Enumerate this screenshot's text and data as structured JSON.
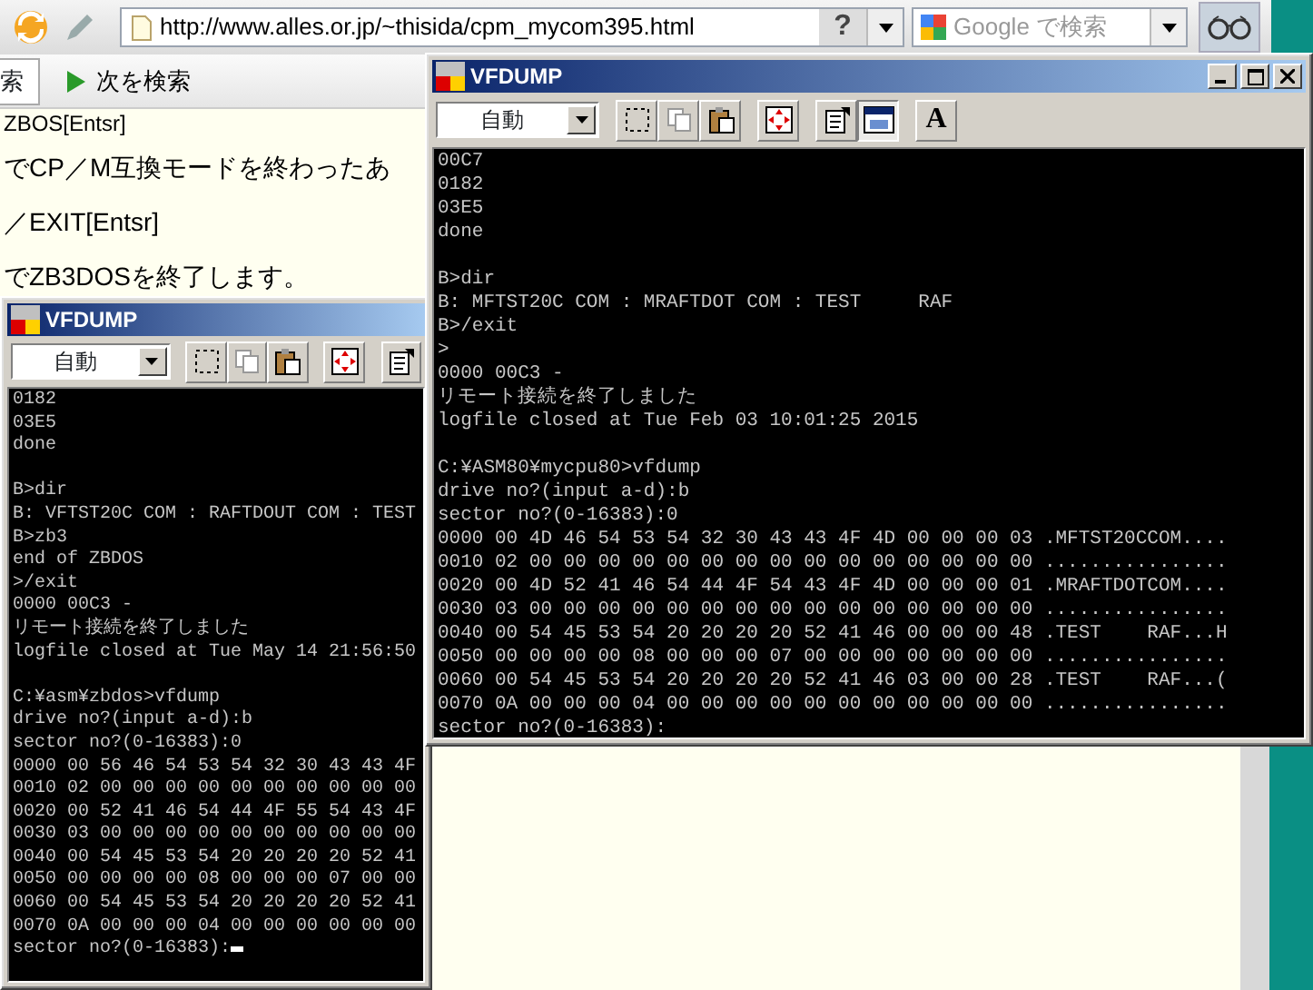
{
  "browser": {
    "url": "http://www.alles.or.jp/~thisida/cpm_mycom395.html",
    "help_label": "?",
    "search_placeholder": "Google で検索"
  },
  "find_bar": {
    "field_text": "索",
    "next_label": "次を検索"
  },
  "page": {
    "lines": [
      "ZBOS[Entsr]",
      "でCP／M互換モードを終わったあ",
      "／EXIT[Entsr]",
      "でZB3DOSを終了します。"
    ]
  },
  "windows": [
    {
      "title": "VFDUMP",
      "controls": false,
      "cursor": true,
      "mode": "自動",
      "toolbar": [
        {
          "kind": "select",
          "pressed": false
        },
        {
          "kind": "copy",
          "pressed": false
        },
        {
          "kind": "paste",
          "pressed": false
        },
        {
          "kind": "fullscreen",
          "pressed": false
        },
        {
          "kind": "properties",
          "pressed": false
        }
      ],
      "console": [
        [
          "0182",
          "03E5",
          "done"
        ],
        [
          "B>dir",
          "B: VFTST20C COM : RAFTDOUT COM : TEST",
          "B>zb3",
          "end of ZBDOS",
          ">/exit",
          "0000 00C3 -",
          "リモート接続を終了しました",
          "logfile closed at Tue May 14 21:56:50"
        ],
        [
          "C:¥asm¥zbdos>vfdump",
          "drive no?(input a-d):b",
          "sector no?(0-16383):0",
          "0000 00 56 46 54 53 54 32 30 43 43 4F",
          "0010 02 00 00 00 00 00 00 00 00 00 00",
          "0020 00 52 41 46 54 44 4F 55 54 43 4F",
          "0030 03 00 00 00 00 00 00 00 00 00 00",
          "0040 00 54 45 53 54 20 20 20 20 52 41",
          "0050 00 00 00 00 08 00 00 00 07 00 00",
          "0060 00 54 45 53 54 20 20 20 20 52 41",
          "0070 0A 00 00 00 04 00 00 00 00 00 00",
          "sector no?(0-16383):"
        ]
      ]
    },
    {
      "title": "VFDUMP",
      "controls": true,
      "cursor": false,
      "mode": "自動",
      "toolbar": [
        {
          "kind": "select",
          "pressed": false
        },
        {
          "kind": "copy",
          "pressed": false
        },
        {
          "kind": "paste",
          "pressed": false
        },
        {
          "kind": "fullscreen",
          "pressed": false
        },
        {
          "kind": "properties",
          "pressed": false
        },
        {
          "kind": "background",
          "pressed": true
        },
        {
          "kind": "font",
          "pressed": false,
          "label": "A"
        }
      ],
      "console": [
        [
          "00C7",
          "0182",
          "03E5",
          "done"
        ],
        [
          "B>dir",
          "B: MFTST20C COM : MRAFTDOT COM : TEST     RAF",
          "B>/exit",
          ">",
          "0000 00C3 -",
          "リモート接続を終了しました",
          "logfile closed at Tue Feb 03 10:01:25 2015"
        ],
        [
          "C:¥ASM80¥mycpu80>vfdump",
          "drive no?(input a-d):b",
          "sector no?(0-16383):0",
          "0000 00 4D 46 54 53 54 32 30 43 43 4F 4D 00 00 00 03 .MFTST20CCOM....",
          "0010 02 00 00 00 00 00 00 00 00 00 00 00 00 00 00 00 ................",
          "0020 00 4D 52 41 46 54 44 4F 54 43 4F 4D 00 00 00 01 .MRAFTDOTCOM....",
          "0030 03 00 00 00 00 00 00 00 00 00 00 00 00 00 00 00 ................",
          "0040 00 54 45 53 54 20 20 20 20 52 41 46 00 00 00 48 .TEST    RAF...H",
          "0050 00 00 00 00 08 00 00 00 07 00 00 00 00 00 00 00 ................",
          "0060 00 54 45 53 54 20 20 20 20 52 41 46 03 00 00 28 .TEST    RAF...(",
          "0070 0A 00 00 00 04 00 00 00 00 00 00 00 00 00 00 00 ................",
          "sector no?(0-16383):"
        ]
      ]
    }
  ]
}
